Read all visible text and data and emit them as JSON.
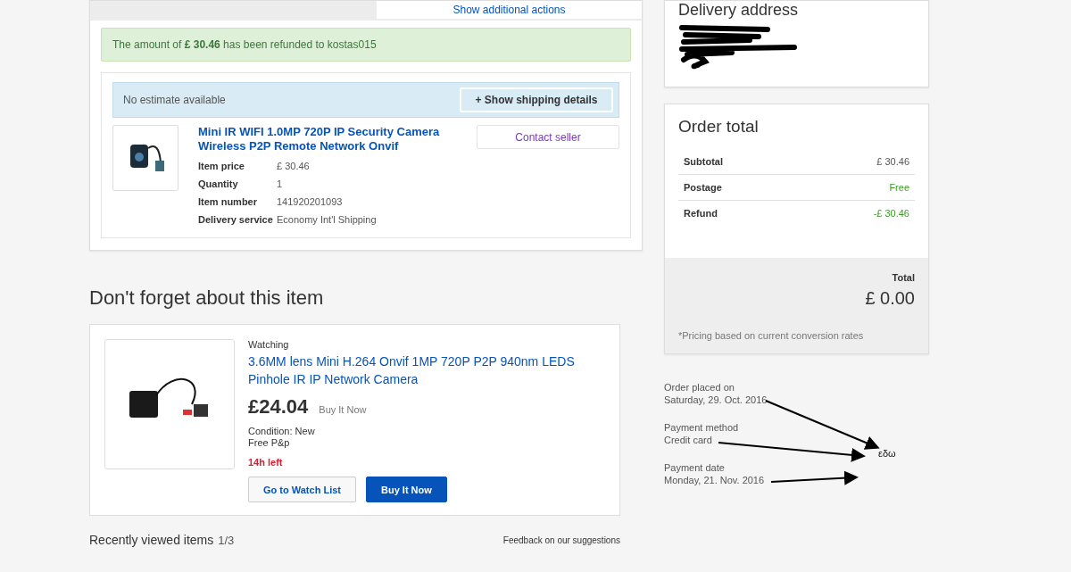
{
  "order_actions": {
    "button": "Show additional actions"
  },
  "refund_notice": "The amount of **£ 30.46** has been refunded to kostas015",
  "shipping": {
    "estimate": "No estimate available",
    "button": "+ Show shipping details"
  },
  "item": {
    "title": "Mini IR WIFI 1.0MP 720P IP Security Camera Wireless P2P Remote Network Onvif",
    "contact_button": "Contact seller",
    "details": [
      {
        "label": "Item price",
        "value": "£ 30.46"
      },
      {
        "label": "Quantity",
        "value": "1"
      },
      {
        "label": "Item number",
        "value": "141920201093"
      },
      {
        "label": "Delivery service",
        "value": "Economy Int'l Shipping"
      }
    ]
  },
  "suggestion": {
    "heading": "Don't forget about this item",
    "status": "Watching",
    "title": "3.6MM lens Mini H.264 Onvif 1MP 720P P2P 940nm LEDS Pinhole IR IP Network Camera",
    "price": "£24.04",
    "format": "Buy It Now",
    "condition": "Condition: New",
    "postage": "Free P&p",
    "time_left": "14h left",
    "buttons": [
      {
        "label": "Go to Watch List",
        "kind": "secondary"
      },
      {
        "label": "Buy It Now",
        "kind": "primary"
      }
    ]
  },
  "recently_viewed": {
    "title": "Recently viewed items",
    "count": "1/3",
    "feedback": "Feedback on our suggestions"
  },
  "delivery_address": {
    "heading": "Delivery address"
  },
  "order_total": {
    "heading": "Order total",
    "rows": [
      {
        "label": "Subtotal",
        "value": "£ 30.46",
        "kind": "plain"
      },
      {
        "label": "Postage",
        "value": "Free",
        "kind": "positive"
      },
      {
        "label": "Refund",
        "value": "-£ 30.46",
        "kind": "positive"
      }
    ],
    "total_label": "Total",
    "total_value": "£ 0.00",
    "note": "*Pricing based on current conversion rates"
  },
  "order_info": [
    {
      "label": "Order placed on",
      "value": "Saturday, 29. Oct. 2016"
    },
    {
      "label": "Payment method",
      "value": "Credit card"
    },
    {
      "label": "Payment date",
      "value": "Monday, 21. Nov. 2016"
    }
  ],
  "annotation": "εδω"
}
